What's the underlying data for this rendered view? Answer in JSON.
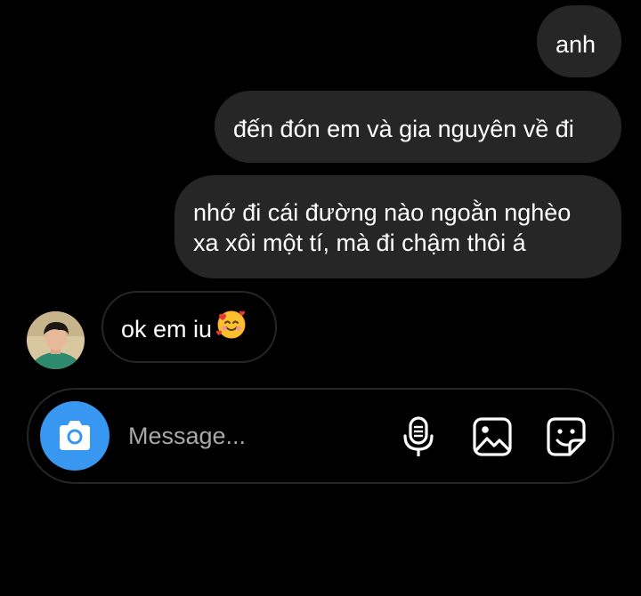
{
  "thread": {
    "messages": [
      {
        "direction": "outgoing",
        "text": "anh"
      },
      {
        "direction": "outgoing",
        "text": "đến đón em và gia nguyên về đi"
      },
      {
        "direction": "outgoing",
        "text": "nhớ đi cái đường nào ngoằn nghèo\nxa xôi một tí, mà đi chậm thôi á"
      },
      {
        "direction": "incoming",
        "text": "ok em iu",
        "emoji": "smiling-face-with-hearts"
      }
    ]
  },
  "composer": {
    "placeholder": "Message...",
    "value": "",
    "actions": [
      "camera-icon",
      "microphone-icon",
      "gallery-icon",
      "sticker-icon"
    ]
  },
  "colors": {
    "background": "#000000",
    "bubble": "#262626",
    "text": "#ffffff",
    "placeholder": "#a8a8a8",
    "accent": "#3897f0"
  }
}
